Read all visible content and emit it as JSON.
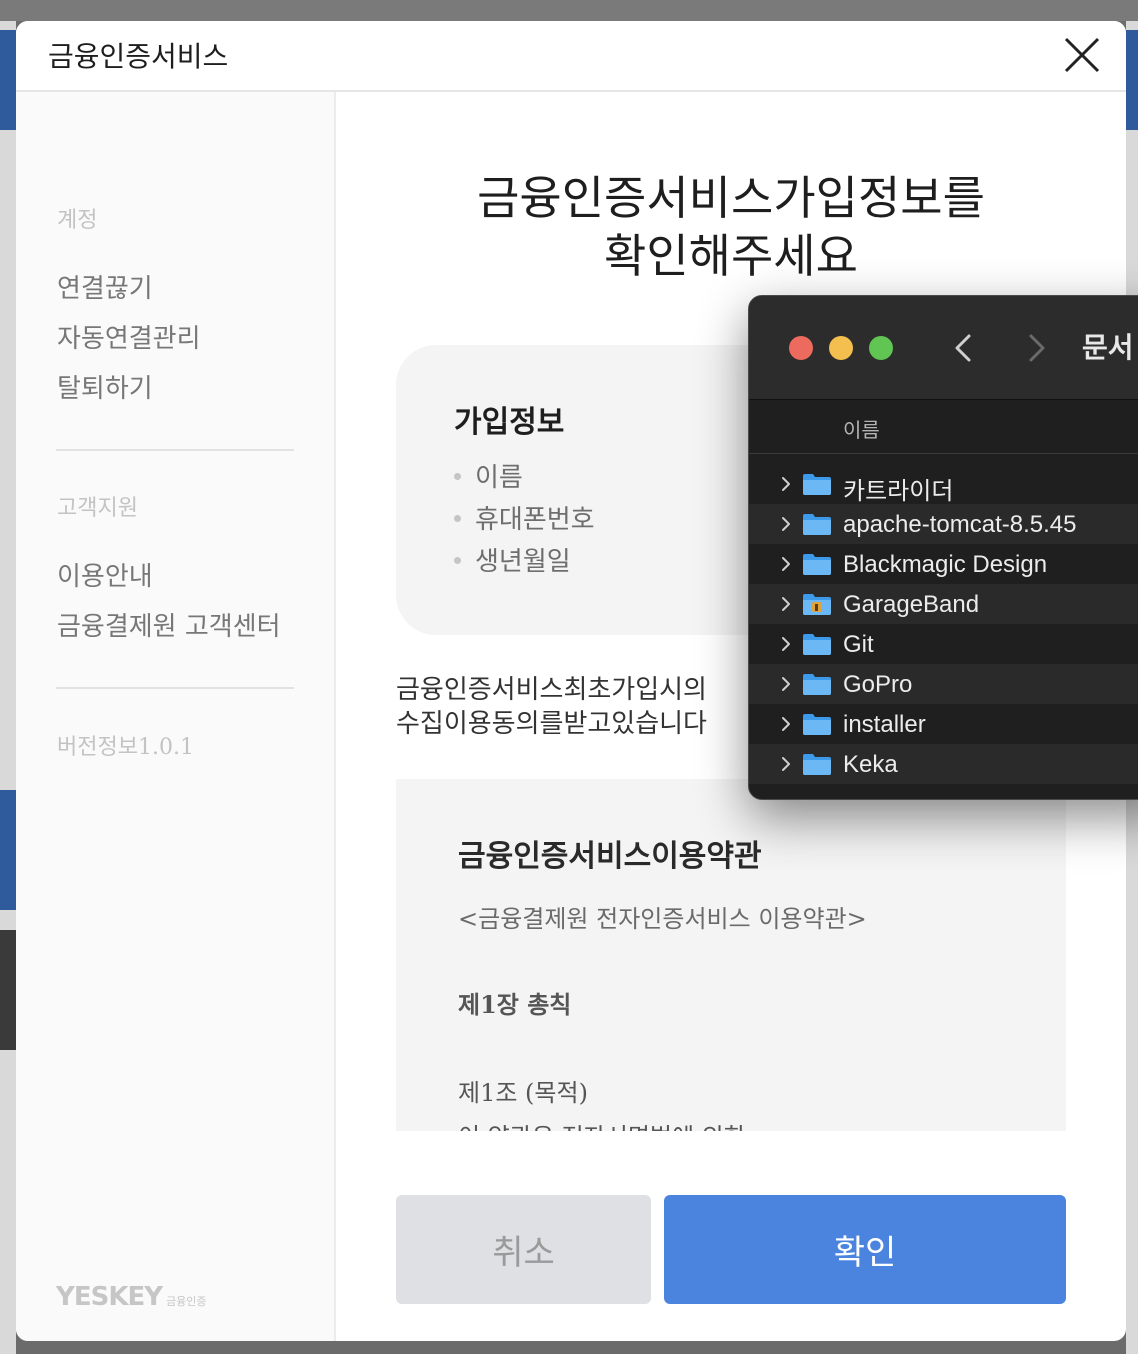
{
  "modal": {
    "title": "금융인증서비스",
    "close_label": "×"
  },
  "sidebar": {
    "section_account": "계정",
    "account_items": [
      "연결끊기",
      "자동연결관리",
      "탈퇴하기"
    ],
    "section_support": "고객지원",
    "support_items": [
      "이용안내",
      "금융결제원 고객센터"
    ],
    "version": "버전정보1.0.1",
    "brand": "YESKEY",
    "brand_sub": "금융인증"
  },
  "main": {
    "title_line1": "금융인증서비스가입정보를",
    "title_line2": "확인해주세요",
    "info_card": {
      "title": "가입정보",
      "items": [
        "이름",
        "휴대폰번호",
        "생년월일"
      ]
    },
    "consent_line1": "금융인증서비스최초가입시의",
    "consent_line2": "수집이용동의를받고있습니다",
    "terms": {
      "title": "금융인증서비스이용약관",
      "subtitle": "<금융결제원 전자인증서비스 이용약관>",
      "chapter": "제1장 총칙",
      "article": "제1조 (목적)",
      "article_body": "이 약관은 전자서명법에 의한"
    },
    "cancel_label": "취소",
    "ok_label": "확인",
    "colors": {
      "ok": "#4b84de",
      "cancel": "#dfe0e4"
    }
  },
  "finder": {
    "title": "문서",
    "column_name": "이름",
    "rows": [
      {
        "name": "카트라이더",
        "icon": "folder-icon"
      },
      {
        "name": "apache-tomcat-8.5.45",
        "icon": "folder-icon"
      },
      {
        "name": "Blackmagic Design",
        "icon": "folder-icon"
      },
      {
        "name": "GarageBand",
        "icon": "garageband-folder-icon"
      },
      {
        "name": "Git",
        "icon": "folder-icon"
      },
      {
        "name": "GoPro",
        "icon": "folder-icon"
      },
      {
        "name": "installer",
        "icon": "folder-icon"
      },
      {
        "name": "Keka",
        "icon": "folder-icon"
      }
    ]
  }
}
